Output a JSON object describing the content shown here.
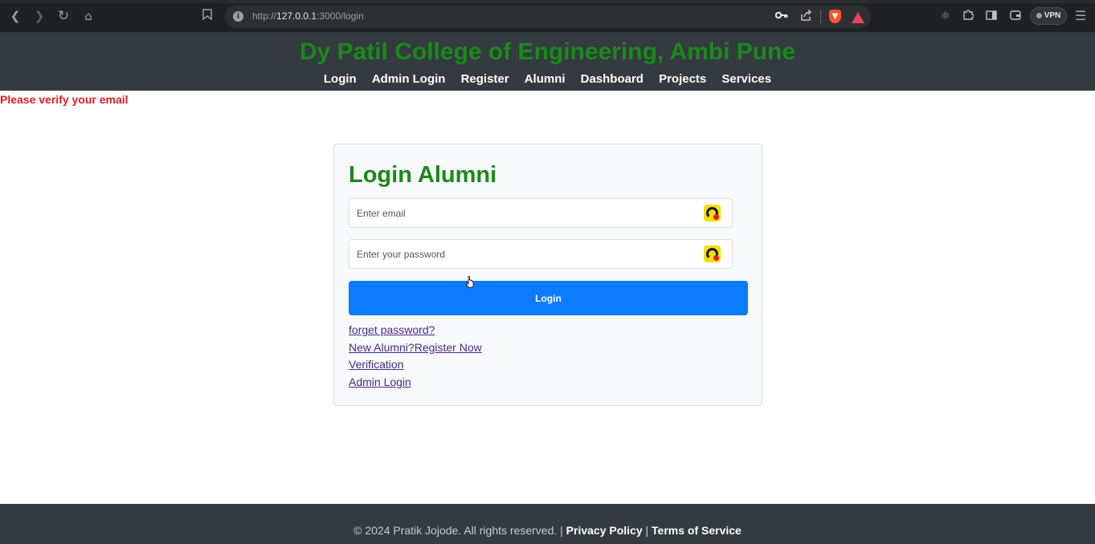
{
  "browser": {
    "url_prefix": "http://",
    "url_host": "127.0.0.1",
    "url_path": ":3000/login",
    "vpn_label": "VPN",
    "icons": [
      "back-icon",
      "forward-icon",
      "reload-icon",
      "home-icon",
      "bookmark-icon",
      "info-icon",
      "key-icon",
      "share-icon",
      "brave-shield-icon",
      "brave-rewards-icon",
      "extension-atom-icon",
      "extensions-puzzle-icon",
      "sidebar-icon",
      "wallet-icon",
      "menu-icon"
    ]
  },
  "header": {
    "title": "Dy Patil College of Engineering, Ambi Pune",
    "nav": [
      "Login",
      "Admin Login",
      "Register",
      "Alumni",
      "Dashboard",
      "Projects",
      "Services"
    ]
  },
  "alert": {
    "message": "Please verify your email",
    "color": "#e31b23"
  },
  "login": {
    "title": "Login Alumni",
    "email_placeholder": "Enter email",
    "password_placeholder": "Enter your password",
    "button_label": "Login",
    "links": [
      "forget password?",
      "New Alumni?Register Now",
      "Verification",
      "Admin Login"
    ]
  },
  "footer": {
    "copyright": "© 2024 Pratik Jojode. All rights reserved. |",
    "privacy": "Privacy Policy",
    "separator": "|",
    "terms": "Terms of Service"
  },
  "colors": {
    "brand_green": "#1a8a1a",
    "header_bg": "#343a40",
    "primary_button": "#0d7bfd"
  }
}
